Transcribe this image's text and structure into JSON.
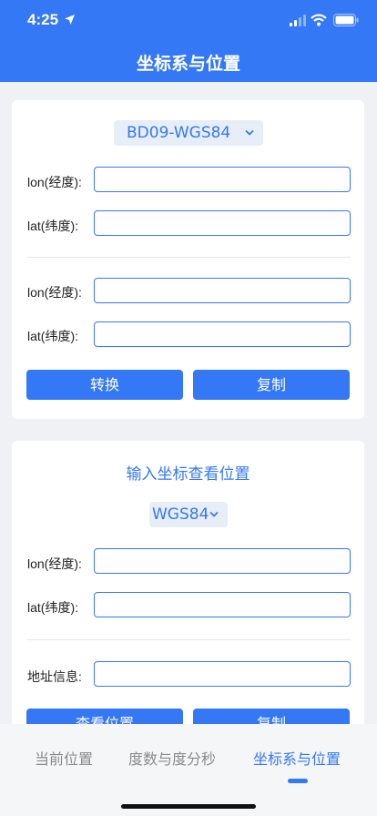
{
  "status_bar": {
    "time": "4:25"
  },
  "header": {
    "title": "坐标系与位置"
  },
  "converter": {
    "system_selected": "BD09-WGS84",
    "source": {
      "lon_label": "lon(经度):",
      "lat_label": "lat(纬度):",
      "lon_value": "",
      "lat_value": ""
    },
    "result": {
      "lon_label": "lon(经度):",
      "lat_label": "lat(纬度):",
      "lon_value": "",
      "lat_value": ""
    },
    "convert_label": "转换",
    "copy_label": "复制"
  },
  "lookup": {
    "title": "输入坐标查看位置",
    "system_selected": "WGS84",
    "lon_label": "lon(经度):",
    "lat_label": "lat(纬度):",
    "lon_value": "",
    "lat_value": "",
    "address_label": "地址信息:",
    "address_value": "",
    "view_label": "查看位置",
    "copy_label": "复制"
  },
  "tabs": [
    {
      "label": "当前位置",
      "active": false
    },
    {
      "label": "度数与度分秒",
      "active": false
    },
    {
      "label": "坐标系与位置",
      "active": true
    }
  ],
  "colors": {
    "accent": "#3478f6",
    "background": "#f0f1f5"
  }
}
